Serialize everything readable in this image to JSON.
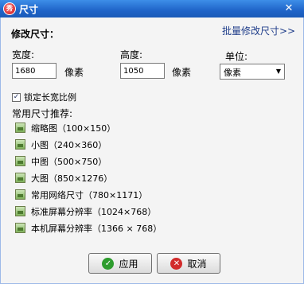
{
  "window": {
    "title": "尺寸",
    "app_icon_text": "秀",
    "close_glyph": "✕"
  },
  "heading": "修改尺寸：",
  "batch_link": "批量修改尺寸>>",
  "width": {
    "label": "宽度:",
    "value": "1680",
    "unit": "像素"
  },
  "height": {
    "label": "高度:",
    "value": "1050",
    "unit": "像素"
  },
  "unit_select": {
    "label": "单位:",
    "value": "像素"
  },
  "lock_ratio": {
    "label": "锁定长宽比例",
    "checked": true
  },
  "presets": {
    "header": "常用尺寸推荐:",
    "items": [
      "缩略图（100×150）",
      "小图（240×360）",
      "中图（500×750）",
      "大图（850×1276）",
      "常用网络尺寸（780×1171）",
      "标准屏幕分辨率（1024×768）",
      "本机屏幕分辨率（1366 × 768）"
    ]
  },
  "buttons": {
    "ok": "应用",
    "cancel": "取消"
  }
}
